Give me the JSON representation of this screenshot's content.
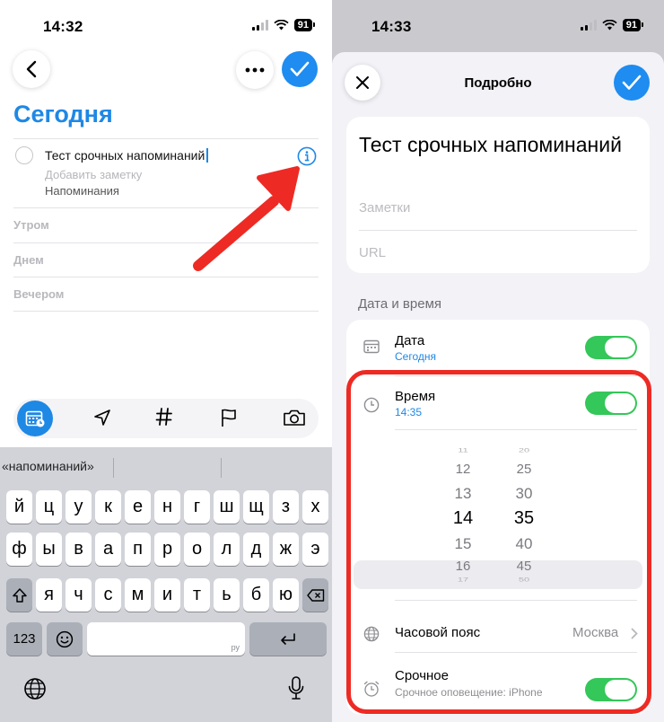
{
  "left": {
    "status": {
      "time": "14:32",
      "battery": "91"
    },
    "title": "Сегодня",
    "reminder": {
      "title": "Тест срочных напоминаний",
      "note_placeholder": "Добавить заметку",
      "list": "Напоминания"
    },
    "sections": [
      "Утром",
      "Днем",
      "Вечером"
    ],
    "toolbar_icons": [
      "calendar-icon",
      "location-arrow-icon",
      "hashtag-icon",
      "flag-icon",
      "camera-icon"
    ],
    "keyboard": {
      "suggestion": "«напоминаний»",
      "row1": [
        "й",
        "ц",
        "у",
        "к",
        "е",
        "н",
        "г",
        "ш",
        "щ",
        "з",
        "х"
      ],
      "row2": [
        "ф",
        "ы",
        "в",
        "а",
        "п",
        "р",
        "о",
        "л",
        "д",
        "ж",
        "э"
      ],
      "row3": [
        "я",
        "ч",
        "с",
        "м",
        "и",
        "т",
        "ь",
        "б",
        "ю"
      ],
      "numbers_key": "123",
      "space_hint": "ру"
    }
  },
  "right": {
    "status": {
      "time": "14:33",
      "battery": "91"
    },
    "sheet_title": "Подробно",
    "reminder_title": "Тест срочных напоминаний",
    "notes_placeholder": "Заметки",
    "url_placeholder": "URL",
    "section_date_time": "Дата и время",
    "date": {
      "label": "Дата",
      "value": "Сегодня",
      "enabled": true
    },
    "time": {
      "label": "Время",
      "value": "14:35",
      "enabled": true
    },
    "picker": {
      "hours": [
        "11",
        "12",
        "13",
        "14",
        "15",
        "16",
        "17"
      ],
      "minutes": [
        "20",
        "25",
        "30",
        "35",
        "40",
        "45",
        "50"
      ],
      "selected_hour": "14",
      "selected_minute": "35"
    },
    "timezone": {
      "label": "Часовой пояс",
      "value": "Москва"
    },
    "urgent": {
      "label": "Срочное",
      "sub": "Срочное оповещение: iPhone",
      "enabled": true
    }
  },
  "colors": {
    "accent": "#1e88e5",
    "toggle_on": "#34c759",
    "highlight": "#ee2a24"
  }
}
